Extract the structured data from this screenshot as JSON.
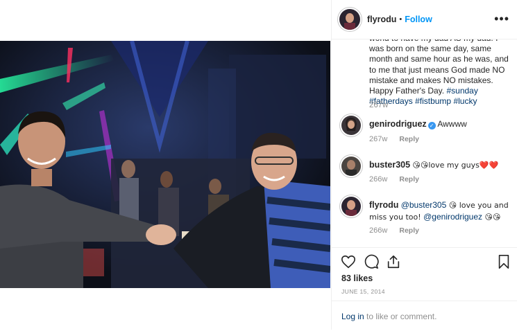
{
  "post": {
    "author": "flyrodu",
    "follow_label": "Follow",
    "separator": "•",
    "more_label": "•••"
  },
  "caption": {
    "line_partial": "world to have my dad AS my dad. I was born on the same day, same month and same hour as he was, and to me that just means God made NO mistake and makes NO mistakes. Happy Father's Day.",
    "hashtags": [
      "#sunday",
      "#fatherdays",
      "#fistbump",
      "#lucky"
    ],
    "time": "267w"
  },
  "comments": [
    {
      "username": "genirodriguez",
      "verified": true,
      "text": "Awwww",
      "time": "267w",
      "reply_label": "Reply"
    },
    {
      "username": "buster305",
      "verified": false,
      "text": "😘😘love my guys❤️❤️",
      "time": "266w",
      "reply_label": "Reply"
    },
    {
      "username": "flyrodu",
      "verified": false,
      "mention_1": "@buster305",
      "text_mid": " 😘 love you and miss you too! ",
      "mention_2": "@genirodriguez",
      "text_end": " 😘😘",
      "time": "266w",
      "reply_label": "Reply"
    }
  ],
  "footer": {
    "likes": "83 likes",
    "date": "JUNE 15, 2014",
    "login_link": "Log in",
    "login_rest": " to like or comment."
  },
  "icons": {
    "like": "heart-icon",
    "comment": "comment-icon",
    "share": "share-icon",
    "save": "bookmark-icon"
  },
  "colors": {
    "follow": "#0095f6",
    "hashtag": "#00376b",
    "muted": "#8e8e8e",
    "verified": "#3897f0",
    "divider": "#efefef"
  }
}
